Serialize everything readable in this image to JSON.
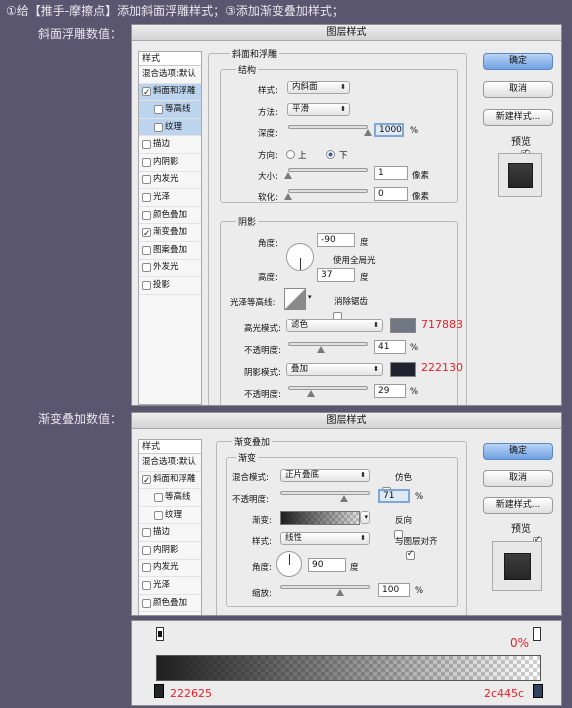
{
  "header": {
    "text": "①给【推手-摩擦点】添加斜面浮雕样式；③添加渐变叠加样式；"
  },
  "section1_label": "斜面浮雕数值：",
  "section2_label": "渐变叠加数值：",
  "colors": {
    "highlight": "#717883",
    "shadow": "#222130",
    "grad_left": "#222625",
    "grad_right": "#2c445c",
    "accent_text": "#e8202a"
  },
  "dialog1": {
    "title": "图层样式",
    "styles_header": "样式",
    "items": [
      {
        "label": "混合选项:默认",
        "cb": false,
        "checked": false,
        "selected": false,
        "sub": false
      },
      {
        "label": "斜面和浮雕",
        "cb": true,
        "checked": true,
        "selected": true,
        "sub": false
      },
      {
        "label": "等高线",
        "cb": true,
        "checked": false,
        "selected": true,
        "sub": true
      },
      {
        "label": "纹理",
        "cb": true,
        "checked": false,
        "selected": true,
        "sub": true
      },
      {
        "label": "描边",
        "cb": true,
        "checked": false,
        "selected": false,
        "sub": false
      },
      {
        "label": "内阴影",
        "cb": true,
        "checked": false,
        "selected": false,
        "sub": false
      },
      {
        "label": "内发光",
        "cb": true,
        "checked": false,
        "selected": false,
        "sub": false
      },
      {
        "label": "光泽",
        "cb": true,
        "checked": false,
        "selected": false,
        "sub": false
      },
      {
        "label": "颜色叠加",
        "cb": true,
        "checked": false,
        "selected": false,
        "sub": false
      },
      {
        "label": "渐变叠加",
        "cb": true,
        "checked": true,
        "selected": false,
        "sub": false
      },
      {
        "label": "图案叠加",
        "cb": true,
        "checked": false,
        "selected": false,
        "sub": false
      },
      {
        "label": "外发光",
        "cb": true,
        "checked": false,
        "selected": false,
        "sub": false
      },
      {
        "label": "投影",
        "cb": true,
        "checked": false,
        "selected": false,
        "sub": false
      }
    ],
    "group_title": "斜面和浮雕",
    "structure_title": "结构",
    "style_label": "样式:",
    "style_value": "内斜面",
    "method_label": "方法:",
    "method_value": "平滑",
    "depth_label": "深度:",
    "depth_value": "1000",
    "depth_unit": "%",
    "depth_level": 1.0,
    "direction_label": "方向:",
    "direction_up": "上",
    "direction_down": "下",
    "direction_selected": "下",
    "size_label": "大小:",
    "size_value": "1",
    "size_unit": "像素",
    "size_level": 0.0,
    "soften_label": "软化:",
    "soften_value": "0",
    "soften_unit": "像素",
    "soften_level": 0.0,
    "shading_title": "阴影",
    "angle_label": "角度:",
    "angle_value": "-90",
    "angle_unit": "度",
    "global_light_label": "使用全局光",
    "global_light_checked": false,
    "altitude_label": "高度:",
    "altitude_value": "37",
    "altitude_unit": "度",
    "gloss_label": "光泽等高线:",
    "antialias_label": "消除锯齿",
    "antialias_checked": false,
    "highlight_mode_label": "高光模式:",
    "highlight_mode_value": "滤色",
    "highlight_hex": "717883",
    "opacity_label": "不透明度:",
    "highlight_opacity": "41",
    "highlight_opacity_level": 0.41,
    "opacity_unit": "%",
    "shadow_mode_label": "阴影模式:",
    "shadow_mode_value": "叠加",
    "shadow_hex": "222130",
    "shadow_opacity": "29",
    "shadow_opacity_level": 0.29,
    "ok": "确定",
    "cancel": "取消",
    "new_style": "新建样式...",
    "preview_label": "预览",
    "preview_checked": true
  },
  "dialog2": {
    "title": "图层样式",
    "styles_header": "样式",
    "items": [
      {
        "label": "混合选项:默认",
        "cb": false,
        "checked": false,
        "selected": false,
        "sub": false
      },
      {
        "label": "斜面和浮雕",
        "cb": true,
        "checked": true,
        "selected": false,
        "sub": false
      },
      {
        "label": "等高线",
        "cb": true,
        "checked": false,
        "selected": false,
        "sub": true
      },
      {
        "label": "纹理",
        "cb": true,
        "checked": false,
        "selected": false,
        "sub": true
      },
      {
        "label": "描边",
        "cb": true,
        "checked": false,
        "selected": false,
        "sub": false
      },
      {
        "label": "内阴影",
        "cb": true,
        "checked": false,
        "selected": false,
        "sub": false
      },
      {
        "label": "内发光",
        "cb": true,
        "checked": false,
        "selected": false,
        "sub": false
      },
      {
        "label": "光泽",
        "cb": true,
        "checked": false,
        "selected": false,
        "sub": false
      },
      {
        "label": "颜色叠加",
        "cb": true,
        "checked": false,
        "selected": false,
        "sub": false
      }
    ],
    "group_title": "渐变叠加",
    "gradient_title": "渐变",
    "blend_label": "混合模式:",
    "blend_value": "正片叠底",
    "dither_label": "仿色",
    "dither_checked": false,
    "opacity_label": "不透明度:",
    "opacity_value": "71",
    "opacity_unit": "%",
    "opacity_level": 0.71,
    "gradient_label": "渐变:",
    "reverse_label": "反向",
    "reverse_checked": false,
    "style_label": "样式:",
    "style_value": "线性",
    "align_label": "与图层对齐",
    "align_checked": true,
    "angle_label": "角度:",
    "angle_value": "90",
    "angle_unit": "度",
    "scale_label": "缩放:",
    "scale_value": "100",
    "scale_unit": "%",
    "scale_level": 0.67,
    "ok": "确定",
    "cancel": "取消",
    "new_style": "新建样式...",
    "preview_label": "预览",
    "preview_checked": true
  },
  "gradient_editor": {
    "top_right_label": "0%",
    "left_hex": "222625",
    "right_hex": "2c445c"
  }
}
